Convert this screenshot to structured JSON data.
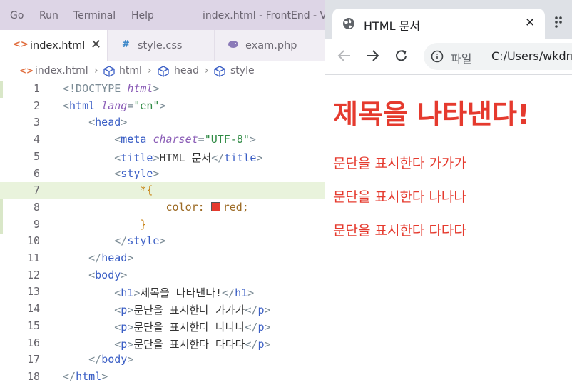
{
  "menubar": {
    "items": [
      "Go",
      "Run",
      "Terminal",
      "Help"
    ],
    "title": "index.html - FrontEnd - Vi"
  },
  "editor_tabs": [
    {
      "label": "index.html",
      "icon": "html-file-icon",
      "active": true
    },
    {
      "label": "style.css",
      "icon": "css-file-icon",
      "active": false
    },
    {
      "label": "exam.php",
      "icon": "php-file-icon",
      "active": false
    }
  ],
  "breadcrumb": [
    "index.html",
    "html",
    "head",
    "style"
  ],
  "code": {
    "line_numbers": [
      "1",
      "2",
      "3",
      "4",
      "5",
      "6",
      "7",
      "8",
      "9",
      "10",
      "11",
      "12",
      "13",
      "14",
      "15",
      "16",
      "17",
      "18"
    ],
    "doctype": "<!DOCTYPE",
    "doctype_kw": "html",
    "html": "html",
    "lang_attr": "lang",
    "lang_val": "\"en\"",
    "head": "head",
    "meta": "meta",
    "charset_attr": "charset",
    "charset_val": "\"UTF-8\"",
    "title_tag": "title",
    "title_text": "HTML 문서",
    "style_tag": "style",
    "selector": "*{",
    "property": "color:",
    "value": "red;",
    "brace_close": "}",
    "body": "body",
    "h1": "h1",
    "h1_text": "제목을 나타낸다!",
    "p": "p",
    "p_texts": [
      "문단을 표시한다 가가가",
      "문단을 표시한다 나나나",
      "문단을 표시한다 다다다"
    ]
  },
  "browser": {
    "tab_title": "HTML 문서",
    "address_label": "파일",
    "address": "C:/Users/wkdrr",
    "page": {
      "h1": "제목을 나타낸다!",
      "paragraphs": [
        "문단을 표시한다 가가가",
        "문단을 표시한다 나나나",
        "문단을 표시한다 다다다"
      ]
    }
  },
  "colors": {
    "rendered_text": "#e53a2e",
    "highlight_line": "#e9f3dc",
    "menubar": "#ddd5e6"
  }
}
